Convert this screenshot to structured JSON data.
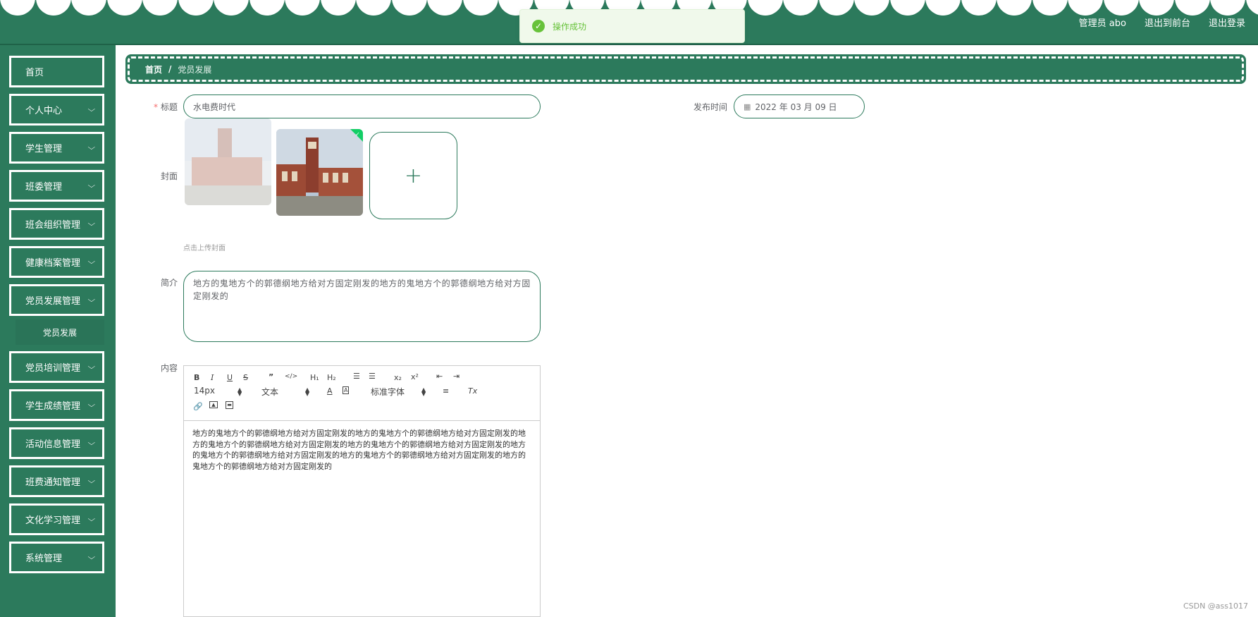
{
  "header": {
    "user_label": "管理员 abo",
    "front_link": "退出到前台",
    "logout_link": "退出登录"
  },
  "toast": {
    "message": "操作成功",
    "color": "#67c23a"
  },
  "theme": {
    "primary": "#2c7a5c"
  },
  "sidebar": {
    "items": [
      {
        "label": "首页"
      },
      {
        "label": "个人中心"
      },
      {
        "label": "学生管理"
      },
      {
        "label": "班委管理"
      },
      {
        "label": "班会组织管理"
      },
      {
        "label": "健康档案管理"
      },
      {
        "label": "党员发展管理"
      },
      {
        "label": "党员培训管理"
      },
      {
        "label": "学生成绩管理"
      },
      {
        "label": "活动信息管理"
      },
      {
        "label": "班费通知管理"
      },
      {
        "label": "文化学习管理"
      },
      {
        "label": "系统管理"
      }
    ],
    "sub_item": "党员发展"
  },
  "breadcrumb": {
    "home": "首页",
    "separator": "/",
    "current": "党员发展"
  },
  "form": {
    "title_label": "标题",
    "title_value": "水电费时代",
    "date_label": "发布时间",
    "date_value": "2022 年 03 月 09 日",
    "cover_label": "封面",
    "cover_hint": "点击上传封面",
    "intro_label": "简介",
    "intro_value": "地方的鬼地方个的郭德纲地方给对方固定刚发的地方的鬼地方个的郭德纲地方给对方固定刚发的",
    "content_label": "内容",
    "content_value": "地方的鬼地方个的郭德纲地方给对方固定刚发的地方的鬼地方个的郭德纲地方给对方固定刚发的地方的鬼地方个的郭德纲地方给对方固定刚发的地方的鬼地方个的郭德纲地方给对方固定刚发的地方的鬼地方个的郭德纲地方给对方固定刚发的地方的鬼地方个的郭德纲地方给对方固定刚发的地方的鬼地方个的郭德纲地方给对方固定刚发的"
  },
  "editor": {
    "font_size": "14px",
    "text_type": "文本",
    "font_family": "标准字体"
  },
  "watermark": "CSDN @ass1017"
}
